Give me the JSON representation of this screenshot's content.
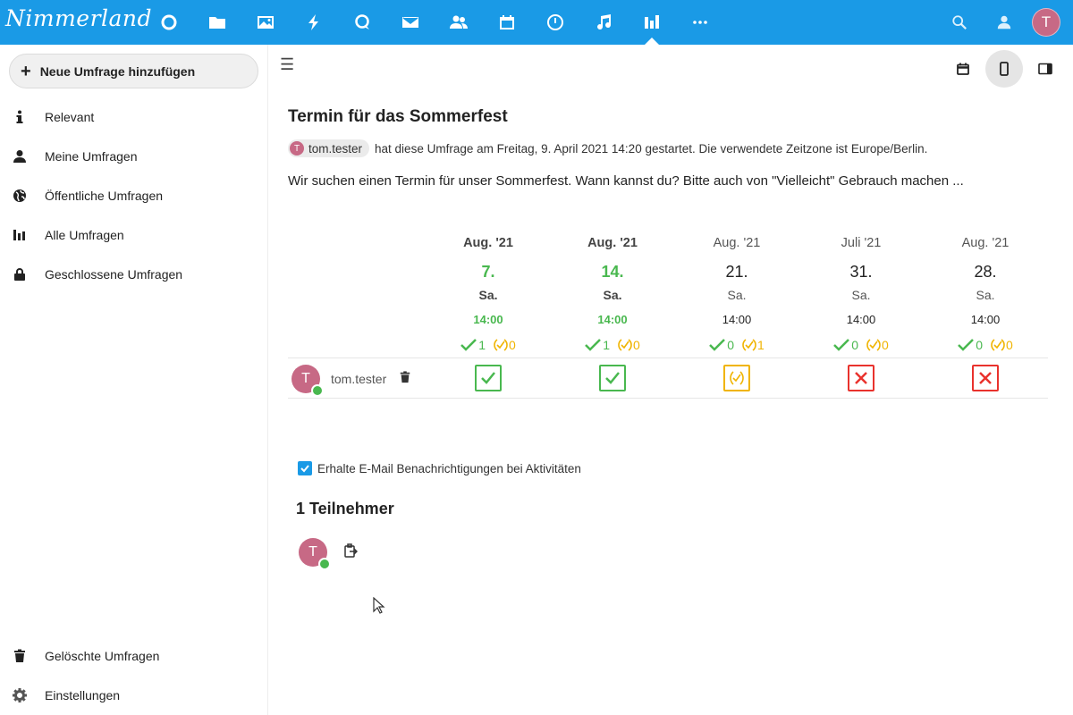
{
  "header": {
    "logo": "Nimmerland",
    "apps": [
      "dashboard-icon",
      "files-icon",
      "photos-icon",
      "activity-icon",
      "talk-icon",
      "mail-icon",
      "contacts-icon",
      "calendar-icon",
      "deck-icon",
      "music-icon",
      "polls-icon",
      "more-icon"
    ],
    "active_app": "polls-icon",
    "avatar_initial": "T"
  },
  "sidebar": {
    "new_poll": "Neue Umfrage hinzufügen",
    "items": [
      {
        "label": "Relevant",
        "icon": "info-icon"
      },
      {
        "label": "Meine Umfragen",
        "icon": "user-icon"
      },
      {
        "label": "Öffentliche Umfragen",
        "icon": "globe-icon"
      },
      {
        "label": "Alle Umfragen",
        "icon": "polls-icon"
      },
      {
        "label": "Geschlossene Umfragen",
        "icon": "lock-icon"
      }
    ],
    "bottom_items": [
      {
        "label": "Gelöschte Umfragen",
        "icon": "trash-icon"
      },
      {
        "label": "Einstellungen",
        "icon": "gear-icon"
      }
    ]
  },
  "poll": {
    "title": "Termin für das Sommerfest",
    "owner": "tom.tester",
    "owner_initial": "T",
    "meta": "hat diese Umfrage am Freitag, 9. April 2021 14:20 gestartet. Die verwendete Zeitzone ist Europe/Berlin.",
    "description": "Wir suchen einen Termin für unser Sommerfest. Wann kannst du? Bitte auch von \"Vielleicht\" Gebrauch machen ...",
    "options": [
      {
        "month": "Aug. '21",
        "day": "7.",
        "dow": "Sa.",
        "time": "14:00",
        "yes": "1",
        "maybe": "0"
      },
      {
        "month": "Aug. '21",
        "day": "14.",
        "dow": "Sa.",
        "time": "14:00",
        "yes": "1",
        "maybe": "0"
      },
      {
        "month": "Aug. '21",
        "day": "21.",
        "dow": "Sa.",
        "time": "14:00",
        "yes": "0",
        "maybe": "1"
      },
      {
        "month": "Juli '21",
        "day": "31.",
        "dow": "Sa.",
        "time": "14:00",
        "yes": "0",
        "maybe": "0"
      },
      {
        "month": "Aug. '21",
        "day": "28.",
        "dow": "Sa.",
        "time": "14:00",
        "yes": "0",
        "maybe": "0"
      }
    ],
    "voter": {
      "name": "tom.tester",
      "initial": "T",
      "votes": [
        "yes",
        "yes",
        "maybe",
        "no",
        "no"
      ]
    },
    "notify_label": "Erhalte E-Mail Benachrichtigungen bei Aktivitäten",
    "notify_checked": true,
    "participants_title": "1 Teilnehmer",
    "participant_initial": "T"
  },
  "colors": {
    "header": "#1a9ae6",
    "yes": "#49b84f",
    "maybe": "#f0b400",
    "no": "#e9322d",
    "avatar": "#c76985"
  }
}
